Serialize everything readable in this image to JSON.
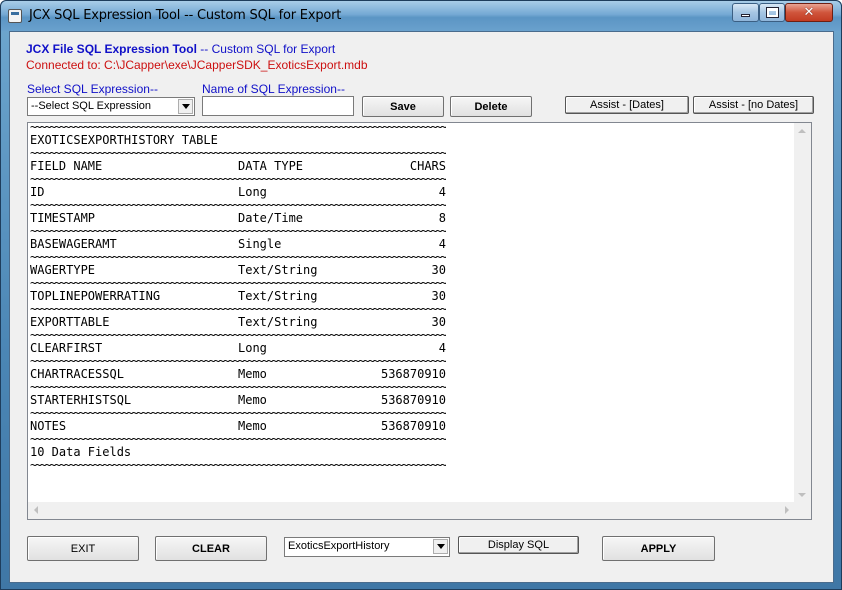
{
  "window": {
    "title": "JCX SQL Expression Tool -- Custom SQL for Export",
    "close_glyph": "✕"
  },
  "header": {
    "tool_name": "JCX File SQL Expression Tool",
    "tool_suffix": " -- Custom SQL for Export",
    "connection": "Connected to: C:\\JCapper\\exe\\JCapperSDK_ExoticsExport.mdb"
  },
  "controls": {
    "select_label": "Select SQL Expression--",
    "select_value": "--Select SQL Expression",
    "name_label": "Name of SQL Expression--",
    "name_value": "",
    "save_label": "Save",
    "delete_label": "Delete",
    "assist_dates_label": "Assist - [Dates]",
    "assist_nodates_label": "Assist - [no Dates]"
  },
  "output": {
    "rule": "~~~~~~~~~~~~~~~~~~~~~~~~~~~~~~~~~~~~~~~~~~~~~~~~~~~~~~~~~~~~~~~~~~~~~~~~~~~~~~~~~~~~~~~~~~~~~~~~~~~~~~~~~~~~~~~~~~~~",
    "table_title": "EXOTICSEXPORTHISTORY TABLE",
    "headers": [
      "FIELD NAME",
      "DATA TYPE",
      "CHARS"
    ],
    "rows": [
      {
        "name": "ID",
        "type": "Long",
        "chars": "4"
      },
      {
        "name": "TIMESTAMP",
        "type": "Date/Time",
        "chars": "8"
      },
      {
        "name": "BASEWAGERAMT",
        "type": "Single",
        "chars": "4"
      },
      {
        "name": "WAGERTYPE",
        "type": "Text/String",
        "chars": "30"
      },
      {
        "name": "TOPLINEPOWERRATING",
        "type": "Text/String",
        "chars": "30"
      },
      {
        "name": "EXPORTTABLE",
        "type": "Text/String",
        "chars": "30"
      },
      {
        "name": "CLEARFIRST",
        "type": "Long",
        "chars": "4"
      },
      {
        "name": "CHARTRACESSQL",
        "type": "Memo",
        "chars": "536870910"
      },
      {
        "name": "STARTERHISTSQL",
        "type": "Memo",
        "chars": "536870910"
      },
      {
        "name": "NOTES",
        "type": "Memo",
        "chars": "536870910"
      }
    ],
    "footer": "10 Data Fields"
  },
  "bottom": {
    "exit_label": "EXIT",
    "clear_label": "CLEAR",
    "table_select_value": "ExoticsExportHistory",
    "display_sql_label": "Display SQL",
    "apply_label": "APPLY"
  }
}
